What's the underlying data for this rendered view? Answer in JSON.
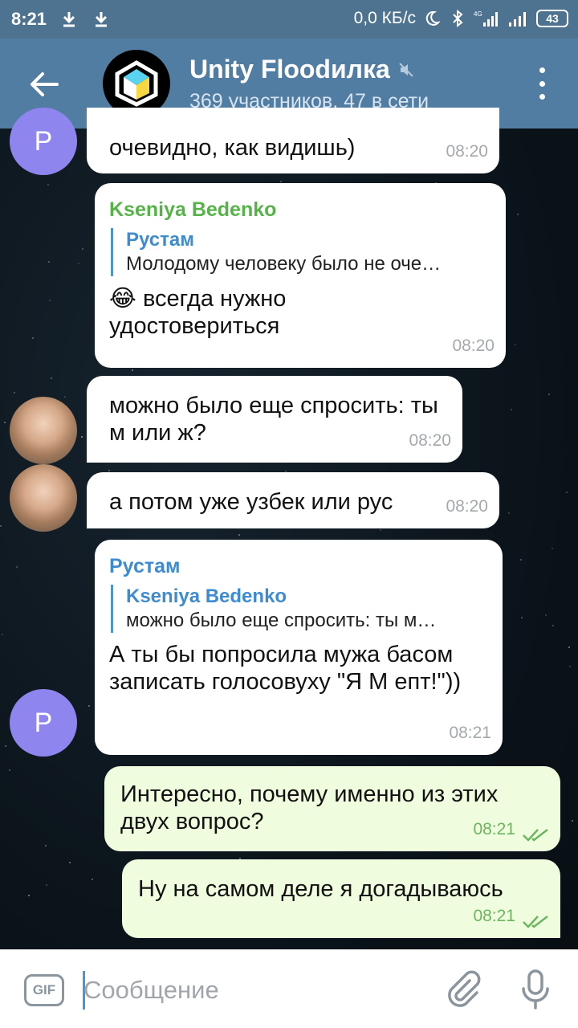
{
  "status_bar": {
    "time": "8:21",
    "net_speed": "0,0 КБ/с",
    "network_type": "4G",
    "battery": "43"
  },
  "header": {
    "title": "Unity Floodилка",
    "subtitle": "369 участников, 47 в сети"
  },
  "messages": [
    {
      "text": "очевидно, как видишь)",
      "time": "08:20"
    },
    {
      "sender": "Kseniya Bedenko",
      "reply_name": "Рустам",
      "reply_text": "Молодому человеку было не оче…",
      "emoji": "😂",
      "text": "всегда нужно удостовериться",
      "time": "08:20"
    },
    {
      "text": "можно было еще спросить: ты м или ж?",
      "time": "08:20"
    },
    {
      "text": "а потом уже узбек или рус",
      "time": "08:20"
    },
    {
      "sender": "Рустам",
      "reply_name": "Kseniya Bedenko",
      "reply_text": "можно было еще спросить: ты м…",
      "text": "А ты бы попросила мужа басом записать голосовуху \"Я М епт!\"))",
      "time": "08:21"
    },
    {
      "text": "Интересно, почему именно из этих двух вопрос?",
      "time": "08:21"
    },
    {
      "text": "Ну на самом деле я догадываюсь",
      "time": "08:21"
    }
  ],
  "avatars": {
    "rustam_letter": "Р"
  },
  "input": {
    "gif_label": "GIF",
    "placeholder": "Сообщение"
  },
  "colors": {
    "header": "#527da3",
    "status_bar": "#4e7391",
    "incoming_bubble": "#ffffff",
    "outgoing_bubble": "#effdde",
    "sender_green": "#56b348",
    "reply_blue": "#3e8bd0",
    "outgoing_time": "#6cb55f",
    "avatar_purple": "#8e85ee"
  }
}
